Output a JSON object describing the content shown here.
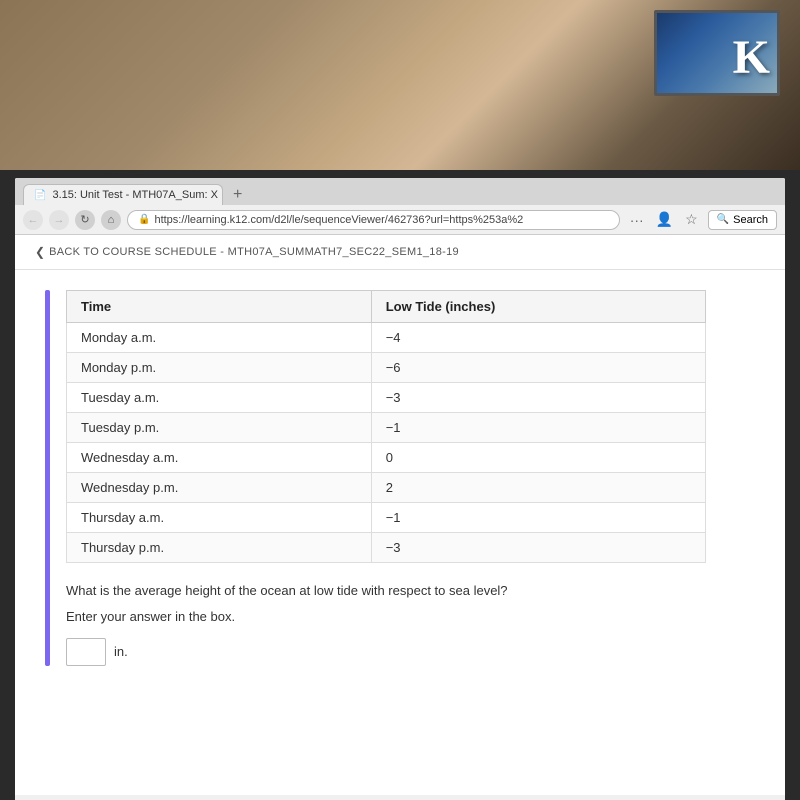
{
  "room": {
    "description": "Physical room background with TV"
  },
  "browser": {
    "tab_title": "3.15: Unit Test - MTH07A_Sum: X",
    "tab_favicon": "📄",
    "new_tab_label": "+",
    "back_btn": "←",
    "forward_btn": "→",
    "refresh_btn": "↻",
    "home_btn": "⌂",
    "url": "https://learning.k12.com/d2l/le/sequenceViewer/462736?url=https%253a%2",
    "more_btn": "···",
    "bookmark_btn": "☆",
    "search_label": "Search"
  },
  "nav": {
    "back_link": "BACK TO COURSE SCHEDULE - MTH07A_SUMMATH7_SEC22_SEM1_18-19",
    "chevron": "<"
  },
  "table": {
    "col1_header": "Time",
    "col2_header": "Low Tide (inches)",
    "rows": [
      {
        "time": "Monday a.m.",
        "tide": "−4"
      },
      {
        "time": "Monday p.m.",
        "tide": "−6"
      },
      {
        "time": "Tuesday a.m.",
        "tide": "−3"
      },
      {
        "time": "Tuesday p.m.",
        "tide": "−1"
      },
      {
        "time": "Wednesday a.m.",
        "tide": "0"
      },
      {
        "time": "Wednesday p.m.",
        "tide": "2"
      },
      {
        "time": "Thursday a.m.",
        "tide": "−1"
      },
      {
        "time": "Thursday p.m.",
        "tide": "−3"
      }
    ]
  },
  "question": {
    "text": "What is the average height of the ocean at low tide with respect to sea level?",
    "instruction": "Enter your answer in the box.",
    "answer_value": "",
    "answer_placeholder": "",
    "unit": "in."
  }
}
